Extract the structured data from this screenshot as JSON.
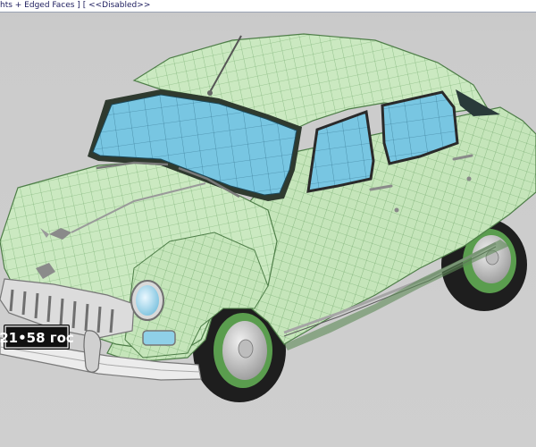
{
  "viewport": {
    "label_prefix": "hts + Edged Faces ]",
    "label_separator": "[",
    "label_state": "<<Disabled>>",
    "background_color": "#cccccc"
  },
  "model": {
    "license_plate": "21•58 гос",
    "body_color": "#c9e8bf",
    "wire_color": "#5b8f55",
    "glass_color": "#7ecbe3",
    "tire_color": "#1e1e1e",
    "hub_color": "#d8d8d8"
  }
}
